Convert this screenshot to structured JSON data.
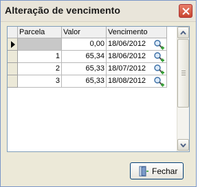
{
  "window": {
    "title": "Alteração de vencimento"
  },
  "grid": {
    "columns": [
      "Parcela",
      "Valor",
      "Vencimento"
    ],
    "rows": [
      {
        "parcela": "",
        "valor": "0,00",
        "vencimento": "18/06/2012",
        "selected": true
      },
      {
        "parcela": "1",
        "valor": "65,34",
        "vencimento": "18/06/2012",
        "selected": false
      },
      {
        "parcela": "2",
        "valor": "65,33",
        "vencimento": "18/07/2012",
        "selected": false
      },
      {
        "parcela": "3",
        "valor": "65,33",
        "vencimento": "18/08/2012",
        "selected": false
      }
    ],
    "row_icon": "magnifier-plus-icon"
  },
  "footer": {
    "fechar_label": "Fechar",
    "fechar_icon": "door-exit-icon"
  },
  "colors": {
    "title_bar": "#e9e5da",
    "close_button": "#d5573f",
    "selection": "#c8c8c8",
    "frame_border": "#7f9db9"
  }
}
